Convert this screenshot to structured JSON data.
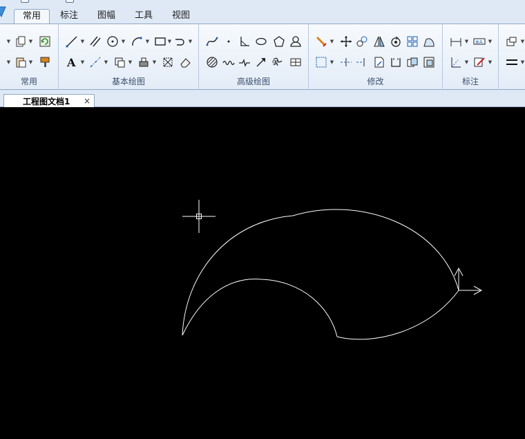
{
  "ribbon_tabs": [
    "常用",
    "标注",
    "图幅",
    "工具",
    "视图"
  ],
  "groups": {
    "common": "常用",
    "basic_draw": "基本绘图",
    "advanced_draw": "高级绘图",
    "modify": "修改",
    "dimension": "标注"
  },
  "document": {
    "tab_title": "工程图文档1",
    "close_symbol": "×"
  },
  "colors": {
    "ribbon_bg": "#dfe9f5",
    "canvas_bg": "#000000",
    "geometry": "#ffffff",
    "icon_blue": "#1a5fb4",
    "icon_orange": "#d8841c"
  },
  "icons": {
    "common_group": [
      "copy-icon",
      "refresh-icon",
      "paste-icon",
      "format-painter-icon"
    ],
    "basic_draw_group": [
      "line-icon",
      "parallel-line-icon",
      "circle-icon",
      "arc-icon",
      "rectangle-icon",
      "polyline-icon",
      "text-icon",
      "centerline-icon",
      "hatch-icon",
      "block-icon",
      "cross-box-icon",
      "eraser-icon"
    ],
    "advanced_draw_group": [
      "spline-icon",
      "point-icon",
      "angle-line-icon",
      "ellipse-icon",
      "polygon-icon",
      "person-icon",
      "hatch-circle-icon",
      "wave-line-icon",
      "break-line-icon",
      "arrow-icon",
      "symbol-icon",
      "table-icon"
    ],
    "modify_group": [
      "pen-delete-icon",
      "move-icon",
      "mirror-icon",
      "triangle-mirror-icon",
      "rotate-icon",
      "array-icon",
      "scale-icon",
      "trim-icon",
      "extend-icon",
      "dashed-line-icon",
      "stretch-icon",
      "bracket-icon",
      "chamfer-icon",
      "fillet-icon"
    ],
    "dimension_group": [
      "linear-dim-icon",
      "tolerance-icon",
      "coordinate-dim-icon",
      "leader-icon",
      "line-weight-icon"
    ]
  }
}
